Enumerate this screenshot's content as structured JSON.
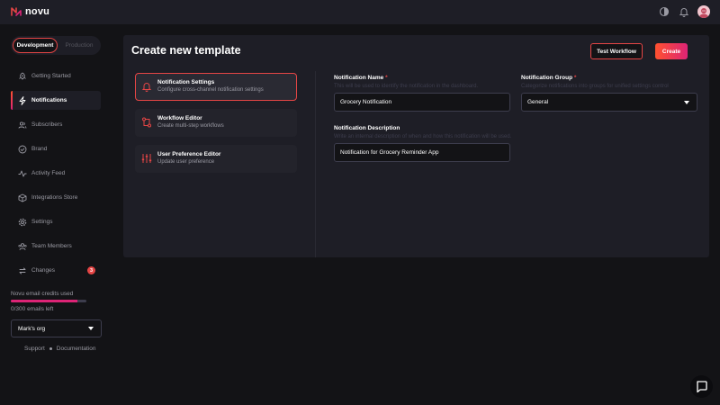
{
  "app": {
    "brand": "novu",
    "colors": {
      "accent": "#e54545",
      "accent_gradient_end": "#dd2476",
      "background": "#131316",
      "surface": "#1e1e26",
      "muted_text": "#9a9aa3"
    }
  },
  "topbar": {
    "icons": [
      "theme-toggle-icon",
      "bell-icon",
      "avatar"
    ]
  },
  "environment": {
    "development_label": "Development",
    "production_label": "Production",
    "selected": "Development"
  },
  "sidebar": {
    "items": [
      {
        "label": "Getting Started",
        "icon": "rocket-icon"
      },
      {
        "label": "Notifications",
        "icon": "bolt-icon",
        "active": true
      },
      {
        "label": "Subscribers",
        "icon": "users-icon"
      },
      {
        "label": "Brand",
        "icon": "check-circle-icon"
      },
      {
        "label": "Activity Feed",
        "icon": "activity-icon"
      },
      {
        "label": "Integrations Store",
        "icon": "box-icon"
      },
      {
        "label": "Settings",
        "icon": "gear-icon"
      },
      {
        "label": "Team Members",
        "icon": "team-icon"
      },
      {
        "label": "Changes",
        "icon": "changes-icon",
        "badge": "3"
      }
    ],
    "credits": {
      "title": "Novu email credits used",
      "fraction_used": 0.88,
      "left_text": "0/300 emails left"
    },
    "org": {
      "name": "Mark's org"
    },
    "footer": {
      "support": "Support",
      "documentation": "Documentation"
    }
  },
  "main": {
    "title": "Create new template",
    "test_workflow_label": "Test Workflow",
    "create_label": "Create",
    "steps": [
      {
        "title": "Notification Settings",
        "subtitle": "Configure cross-channel notification settings",
        "icon": "bell-icon",
        "active": true
      },
      {
        "title": "Workflow Editor",
        "subtitle": "Create multi-step workflows",
        "icon": "workflow-icon"
      },
      {
        "title": "User Preference Editor",
        "subtitle": "Update user preference",
        "icon": "sliders-icon"
      }
    ],
    "form": {
      "name": {
        "label": "Notification Name",
        "required_mark": "*",
        "help": "This will be used to identify the notification in the dashboard.",
        "value": "Grocery Notification"
      },
      "group": {
        "label": "Notification Group",
        "required_mark": "*",
        "help": "Categorize notifications into groups for unified settings control",
        "value": "General"
      },
      "description": {
        "label": "Notification Description",
        "help": "Write an internal description of when and how this notification will be used.",
        "value": "Notification for Grocery Reminder App"
      }
    }
  }
}
